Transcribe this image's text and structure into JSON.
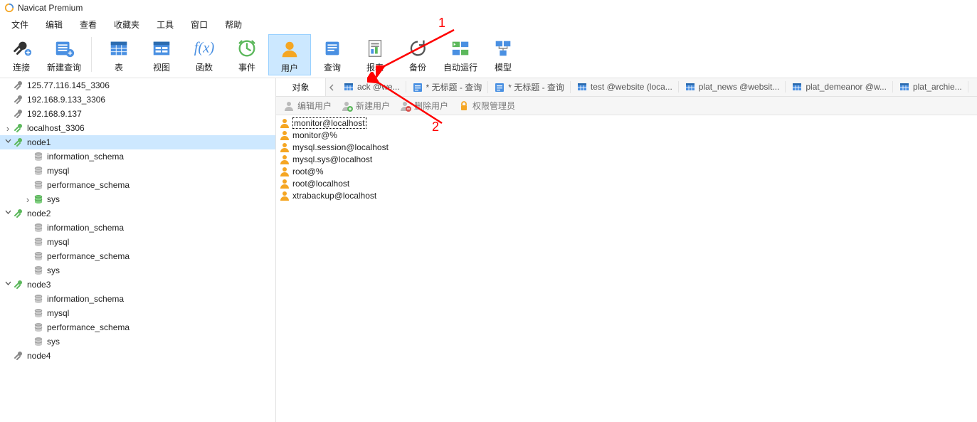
{
  "app": {
    "title": "Navicat Premium"
  },
  "menu": [
    "文件",
    "编辑",
    "查看",
    "收藏夹",
    "工具",
    "窗口",
    "帮助"
  ],
  "toolbar": {
    "groups": [
      [
        {
          "id": "connect",
          "label": "连接",
          "icon": "plug"
        },
        {
          "id": "new-query",
          "label": "新建查询",
          "icon": "query-plus"
        }
      ],
      [
        {
          "id": "table",
          "label": "表",
          "icon": "table"
        },
        {
          "id": "view",
          "label": "视图",
          "icon": "view"
        },
        {
          "id": "function",
          "label": "函数",
          "icon": "fx"
        },
        {
          "id": "event",
          "label": "事件",
          "icon": "clock"
        },
        {
          "id": "user",
          "label": "用户",
          "icon": "user",
          "selected": true
        },
        {
          "id": "query",
          "label": "查询",
          "icon": "query"
        },
        {
          "id": "report",
          "label": "报表",
          "icon": "report"
        },
        {
          "id": "backup",
          "label": "备份",
          "icon": "backup"
        },
        {
          "id": "automation",
          "label": "自动运行",
          "icon": "auto"
        },
        {
          "id": "model",
          "label": "模型",
          "icon": "model"
        }
      ]
    ]
  },
  "tree": [
    {
      "type": "conn",
      "label": "125.77.116.145_3306",
      "state": "closed",
      "level": 0
    },
    {
      "type": "conn",
      "label": "192.168.9.133_3306",
      "state": "closed",
      "level": 0
    },
    {
      "type": "conn",
      "label": "192.168.9.137",
      "state": "closed",
      "level": 0
    },
    {
      "type": "conn-open",
      "label": "localhost_3306",
      "state": "collapsed",
      "level": 0,
      "twist": ">"
    },
    {
      "type": "conn-open",
      "label": "node1",
      "state": "expanded",
      "level": 0,
      "twist": "v",
      "selected": true
    },
    {
      "type": "db",
      "label": "information_schema",
      "level": 1
    },
    {
      "type": "db",
      "label": "mysql",
      "level": 1
    },
    {
      "type": "db",
      "label": "performance_schema",
      "level": 1
    },
    {
      "type": "db-open",
      "label": "sys",
      "level": 1,
      "twist": ">"
    },
    {
      "type": "conn-open",
      "label": "node2",
      "state": "expanded",
      "level": 0,
      "twist": "v"
    },
    {
      "type": "db",
      "label": "information_schema",
      "level": 1
    },
    {
      "type": "db",
      "label": "mysql",
      "level": 1
    },
    {
      "type": "db",
      "label": "performance_schema",
      "level": 1
    },
    {
      "type": "db",
      "label": "sys",
      "level": 1
    },
    {
      "type": "conn-open",
      "label": "node3",
      "state": "expanded",
      "level": 0,
      "twist": "v"
    },
    {
      "type": "db",
      "label": "information_schema",
      "level": 1
    },
    {
      "type": "db",
      "label": "mysql",
      "level": 1
    },
    {
      "type": "db",
      "label": "performance_schema",
      "level": 1
    },
    {
      "type": "db",
      "label": "sys",
      "level": 1
    },
    {
      "type": "conn",
      "label": "node4",
      "state": "closed",
      "level": 0
    }
  ],
  "tabs": {
    "fixed": "对象",
    "items": [
      {
        "label": "ack @we...",
        "icon": "table",
        "dirty": false
      },
      {
        "label": "无标题 - 查询",
        "icon": "query",
        "dirty": true
      },
      {
        "label": "无标题 - 查询",
        "icon": "query",
        "dirty": true
      },
      {
        "label": "test @website (loca...",
        "icon": "table",
        "dirty": false
      },
      {
        "label": "plat_news @websit...",
        "icon": "table",
        "dirty": false
      },
      {
        "label": "plat_demeanor @w...",
        "icon": "table",
        "dirty": false
      },
      {
        "label": "plat_archie...",
        "icon": "table",
        "dirty": false
      }
    ]
  },
  "subtoolbar": [
    {
      "id": "edit-user",
      "label": "编辑用户",
      "icon": "user-grey"
    },
    {
      "id": "new-user",
      "label": "新建用户",
      "icon": "user-plus"
    },
    {
      "id": "delete-user",
      "label": "删除用户",
      "icon": "user-minus"
    },
    {
      "id": "priv-manager",
      "label": "权限管理员",
      "icon": "lock"
    }
  ],
  "users": [
    {
      "name": "monitor@localhost",
      "selected": true
    },
    {
      "name": "monitor@%"
    },
    {
      "name": "mysql.session@localhost"
    },
    {
      "name": "mysql.sys@localhost"
    },
    {
      "name": "root@%"
    },
    {
      "name": "root@localhost"
    },
    {
      "name": "xtrabackup@localhost"
    }
  ],
  "annotations": {
    "one": "1",
    "two": "2"
  }
}
